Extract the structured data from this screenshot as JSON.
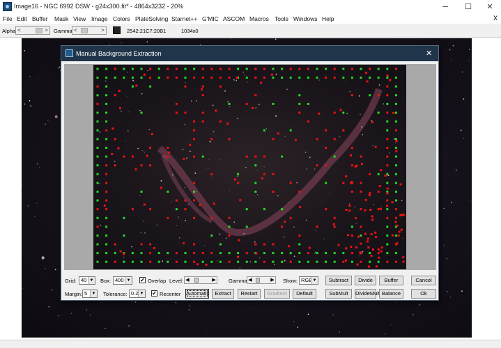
{
  "window": {
    "title": "Image16 - NGC 6992 DSW - g24x300.fit* - 4864x3232 - 20%",
    "controls": {
      "minimize": "─",
      "maximize": "☐",
      "close": "✕"
    }
  },
  "menu": {
    "items": [
      "File",
      "Edit",
      "Buffer",
      "Mask",
      "View",
      "Image",
      "Colors",
      "PlateSolving",
      "Starnet++",
      "G'MIC",
      "ASCOM",
      "Macros",
      "Tools",
      "Windows",
      "Help"
    ],
    "close": "X"
  },
  "toolbar": {
    "alpha_label": "Alpha:",
    "gamma_label": "Gamma:",
    "swatch_color": "#222222",
    "color_value": "2542:21C7:20B1",
    "cursor_value": "1034x0",
    "left_arrow": "<",
    "right_arrow": ">"
  },
  "dialog": {
    "title": "Manual Background Extraction",
    "close": "✕",
    "grid": {
      "label": "Grid:",
      "value": "40"
    },
    "box": {
      "label": "Box:",
      "value": "400"
    },
    "overlap": {
      "label": "Overlap",
      "checked": true
    },
    "level": {
      "label": "Level:"
    },
    "gamma": {
      "label": "Gamma:"
    },
    "show": {
      "label": "Show:",
      "value": "RGB"
    },
    "margin": {
      "label": "Margin:",
      "value": "5"
    },
    "tolerance": {
      "label": "Tolerance:",
      "value": "0.2"
    },
    "recenter": {
      "label": "Recenter",
      "checked": true
    },
    "buttons": {
      "subtract": "Subtract",
      "divide": "Divide",
      "buffer": "Buffer",
      "cancel": "Cancel",
      "automatic": "Automatic",
      "extract": "Extract",
      "restart": "Restart",
      "gradient": "Gradient",
      "default": "Default",
      "submult": "SubMult",
      "dividemult": "DivideMult",
      "balance": "Balance",
      "ok": "Ok"
    },
    "check_mark": "✔",
    "dropdown_glyph": "▼",
    "left_arrow": "◀",
    "right_arrow": "▶"
  },
  "colors": {
    "sample_ok": "#22dd22",
    "sample_rejected": "#ee1111",
    "dialog_title_bg": "#20354a"
  }
}
